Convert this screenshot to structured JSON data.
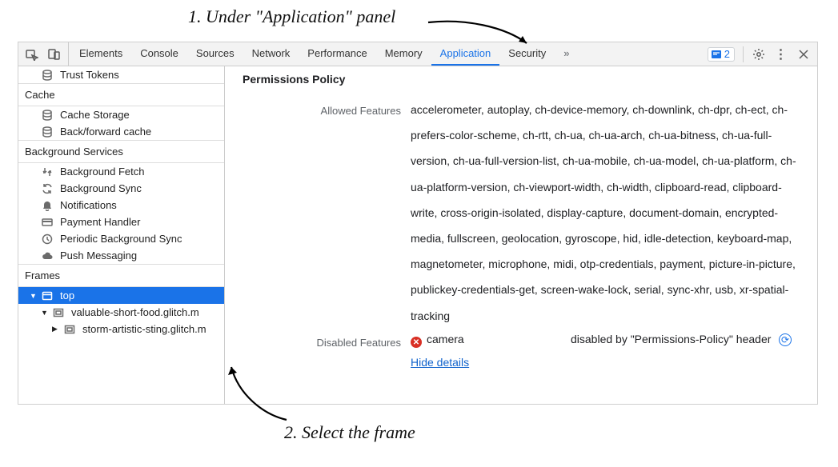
{
  "annotations": {
    "step1": "1. Under \"Application\" panel",
    "step2": "2. Select the frame"
  },
  "toolbar": {
    "tabs": [
      "Elements",
      "Console",
      "Sources",
      "Network",
      "Performance",
      "Memory",
      "Application",
      "Security"
    ],
    "active_tab": "Application",
    "issues_count": "2"
  },
  "sidebar": {
    "items_pre": [
      {
        "label": "Trust Tokens",
        "icon": "database"
      }
    ],
    "sections": [
      {
        "title": "Cache",
        "items": [
          {
            "label": "Cache Storage",
            "icon": "database"
          },
          {
            "label": "Back/forward cache",
            "icon": "database"
          }
        ]
      },
      {
        "title": "Background Services",
        "items": [
          {
            "label": "Background Fetch",
            "icon": "fetch"
          },
          {
            "label": "Background Sync",
            "icon": "sync"
          },
          {
            "label": "Notifications",
            "icon": "bell"
          },
          {
            "label": "Payment Handler",
            "icon": "card"
          },
          {
            "label": "Periodic Background Sync",
            "icon": "clock"
          },
          {
            "label": "Push Messaging",
            "icon": "cloud"
          }
        ]
      },
      {
        "title": "Frames",
        "frame_tree": {
          "top": "top",
          "child1": "valuable-short-food.glitch.m",
          "child2": "storm-artistic-sting.glitch.m"
        }
      }
    ]
  },
  "content": {
    "title": "Permissions Policy",
    "allowed_label": "Allowed Features",
    "allowed_value": "accelerometer, autoplay, ch-device-memory, ch-downlink, ch-dpr, ch-ect, ch-prefers-color-scheme, ch-rtt, ch-ua, ch-ua-arch, ch-ua-bitness, ch-ua-full-version, ch-ua-full-version-list, ch-ua-mobile, ch-ua-model, ch-ua-platform, ch-ua-platform-version, ch-viewport-width, ch-width, clipboard-read, clipboard-write, cross-origin-isolated, display-capture, document-domain, encrypted-media, fullscreen, geolocation, gyroscope, hid, idle-detection, keyboard-map, magnetometer, microphone, midi, otp-credentials, payment, picture-in-picture, publickey-credentials-get, screen-wake-lock, serial, sync-xhr, usb, xr-spatial-tracking",
    "disabled_label": "Disabled Features",
    "disabled_feature": "camera",
    "disabled_reason": "disabled by \"Permissions-Policy\" header",
    "hide_details": "Hide details"
  }
}
